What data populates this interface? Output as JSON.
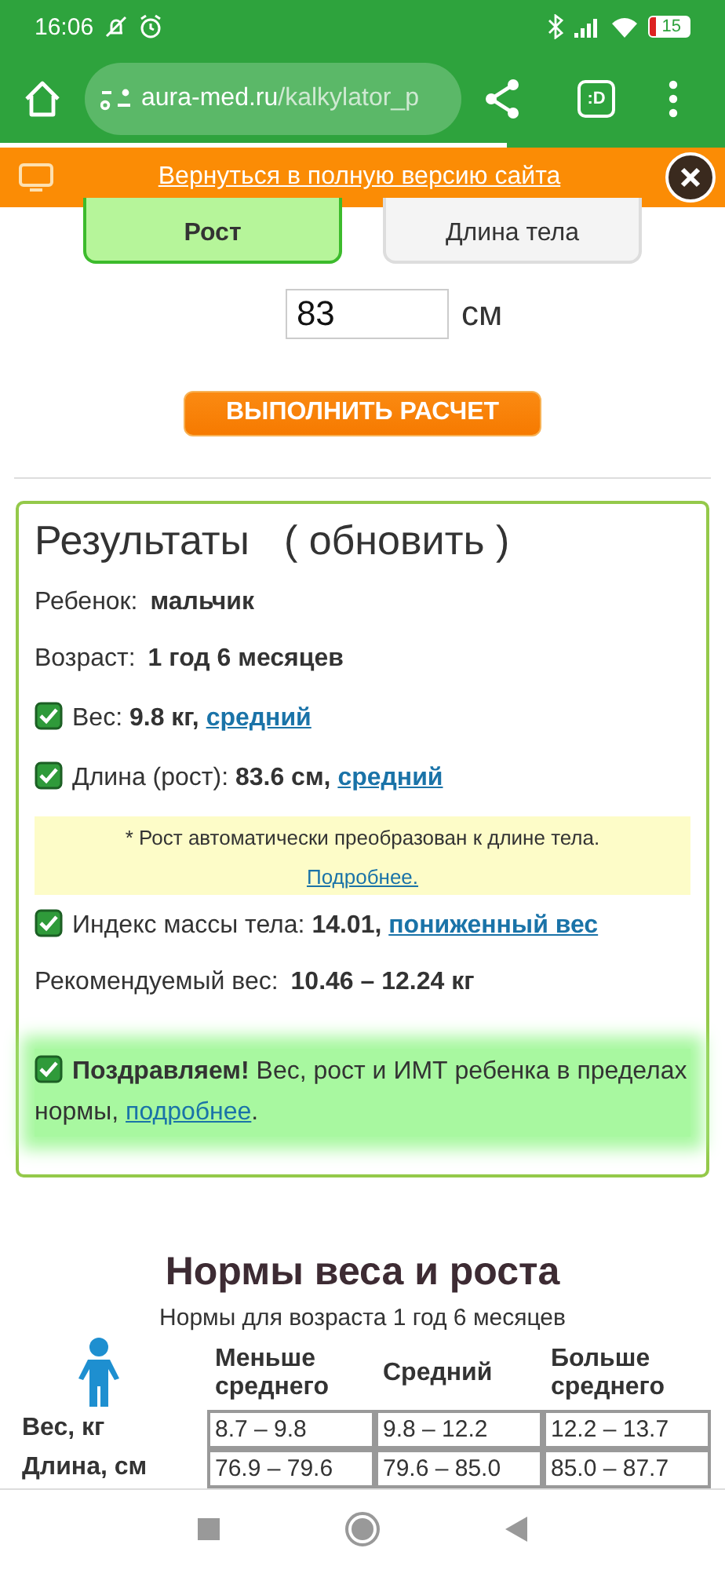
{
  "status_bar": {
    "time": "16:06",
    "battery": "15"
  },
  "browser": {
    "url_host": "aura-med.ru",
    "url_path": "/kalkylator_p",
    "tabs_button": ":D"
  },
  "banner": {
    "link": "Вернуться в полную версию сайта"
  },
  "mode_tabs": [
    {
      "label": "Рост",
      "selected": true
    },
    {
      "label": "Длина тела",
      "selected": false
    }
  ],
  "measure": {
    "value": "83",
    "unit": "см"
  },
  "calc_button": "ВЫПОЛНИТЬ РАСЧЕТ",
  "results": {
    "title": "Результаты",
    "refresh": "( обновить )",
    "lines": [
      {
        "kind": "plain",
        "text": "Ребенок: **мальчик**"
      },
      {
        "kind": "plain",
        "text": "Возраст: **1 год 6 месяцев**"
      },
      {
        "kind": "check",
        "checked": true,
        "text": "Вес: **9.8 кг,**",
        "link": "средний"
      },
      {
        "kind": "check",
        "checked": true,
        "text": "Длина (рост): **83.6 см,**",
        "link": "средний"
      },
      {
        "kind": "note",
        "text": "* Рост автоматически преобразован к длине тела.",
        "link": "Подробнее."
      },
      {
        "kind": "check",
        "checked": true,
        "text": "Индекс массы тела: **14.01,**",
        "link": "пониженный вес"
      },
      {
        "kind": "plain",
        "text": "Рекомендуемый вес: **10.46 – 12.24 кг**"
      },
      {
        "kind": "success",
        "checked": true,
        "text": "**Поздравляем!** Вес, рост и ИМТ ребенка в пределах нормы,",
        "link": "подробнее",
        "tail": "."
      }
    ]
  },
  "norms": {
    "title": "Нормы веса и роста",
    "subtitle": "Нормы для возраста 1 год 6 месяцев",
    "columns": [
      "Меньше среднего",
      "Средний",
      "Больше среднего"
    ],
    "rows": [
      {
        "label": "Вес, кг",
        "cells": [
          "8.7 – 9.8",
          "9.8 – 12.2",
          "12.2 – 13.7"
        ]
      },
      {
        "label": "Длина, см",
        "cells": [
          "76.9 – 79.6",
          "79.6 – 85.0",
          "85.0 – 87.7"
        ]
      }
    ]
  }
}
